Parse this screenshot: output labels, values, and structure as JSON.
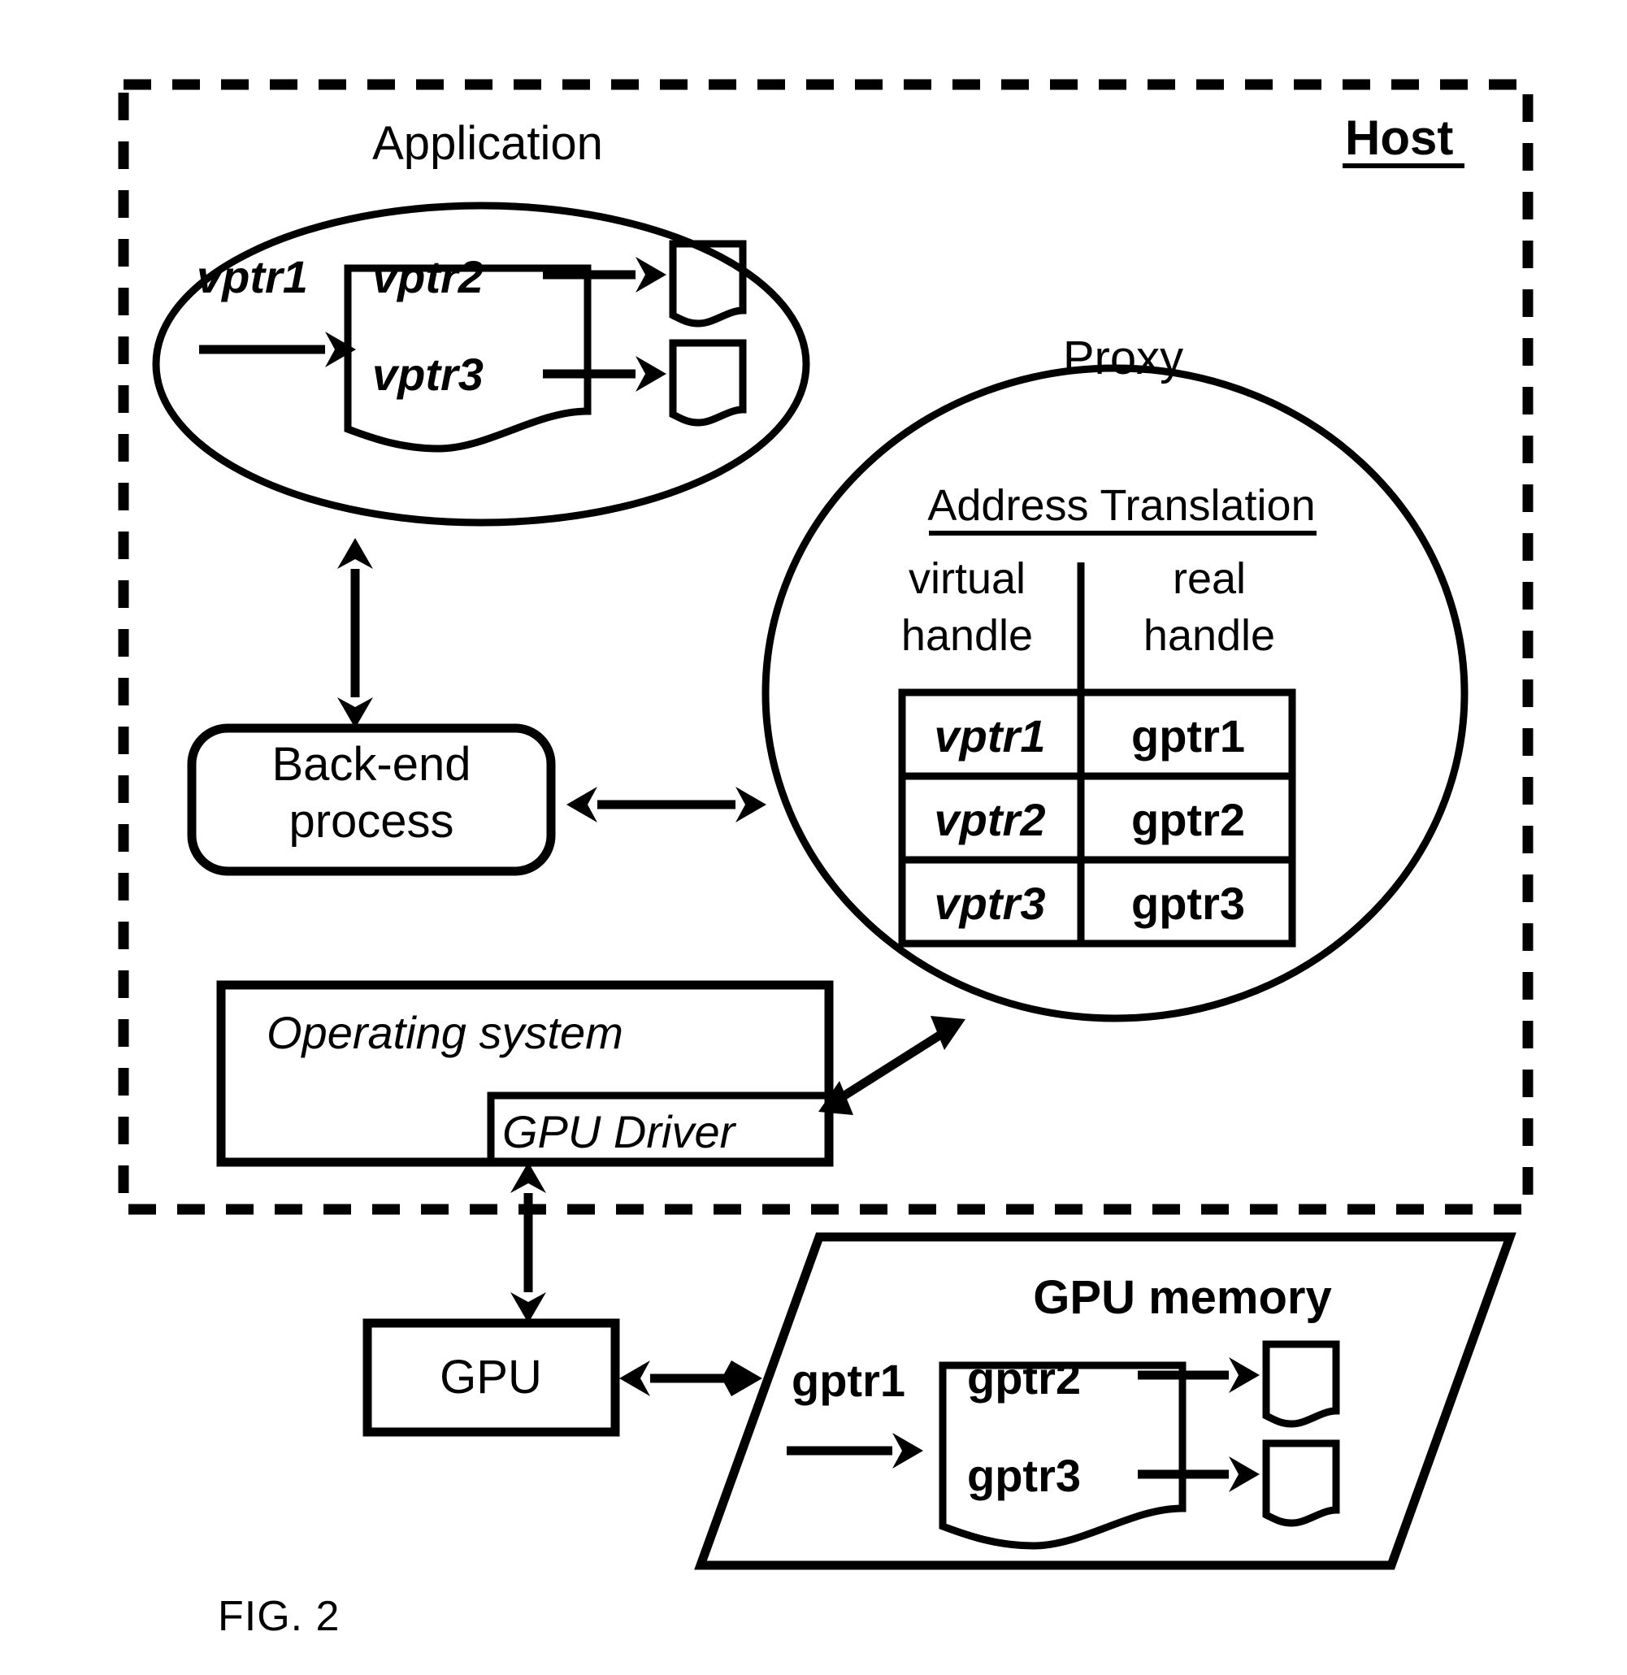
{
  "figure": {
    "caption": "FIG.  2",
    "host_label": "Host"
  },
  "application": {
    "title": "Application",
    "incoming_pointer": "vptr1",
    "entries": [
      "vptr2",
      "vptr3"
    ]
  },
  "proxy": {
    "title": "Proxy",
    "table_title": "Address Translation",
    "columns": [
      {
        "line1": "virtual",
        "line2": "handle"
      },
      {
        "line1": "real",
        "line2": "handle"
      }
    ],
    "rows": [
      {
        "virtual_handle": "vptr1",
        "real_handle": "gptr1"
      },
      {
        "virtual_handle": "vptr2",
        "real_handle": "gptr2"
      },
      {
        "virtual_handle": "vptr3",
        "real_handle": "gptr3"
      }
    ]
  },
  "backend": {
    "line1": "Back-end",
    "line2": "process"
  },
  "os": {
    "label": "Operating system",
    "driver_label": "GPU Driver"
  },
  "gpu": {
    "label": "GPU"
  },
  "gpu_memory": {
    "title": "GPU memory",
    "incoming_pointer": "gptr1",
    "entries": [
      "gptr2",
      "gptr3"
    ]
  },
  "colors": {
    "ink": "#000000",
    "paper": "#ffffff"
  }
}
